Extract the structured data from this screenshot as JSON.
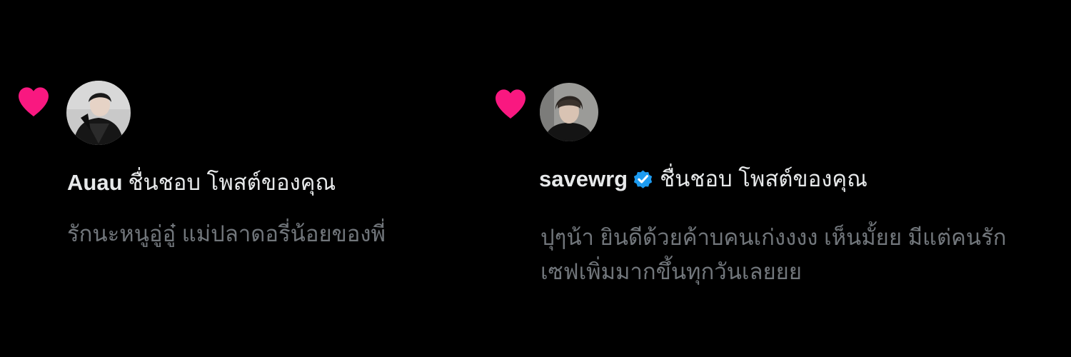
{
  "colors": {
    "background": "#000000",
    "heart": "#f91880",
    "primary_text": "#e7e9ea",
    "secondary_text": "#71767b",
    "verified_badge": "#1d9bf0"
  },
  "notifications": [
    {
      "icon": "heart-icon",
      "avatar_icon": "avatar",
      "username": "Auau",
      "verified": false,
      "action": "ชื่นชอบ โพสต์ของคุณ",
      "post_lines": [
        "รักนะหนูอู่อู๋ แม่ปลาดอรี่น้อยของพี่"
      ]
    },
    {
      "icon": "heart-icon",
      "avatar_icon": "avatar",
      "username": "savewrg",
      "verified": true,
      "verified_icon": "verified-badge-icon",
      "action": "ชื่นชอบ โพสต์ของคุณ",
      "post_lines": [
        "ปุๆน้า ยินดีด้วยค้าบคนเก่งงงง เห็นมั้ยย มีแต่คนรัก",
        "เซฟเพิ่มมากขึ้นทุกวันเลยยย"
      ]
    }
  ]
}
